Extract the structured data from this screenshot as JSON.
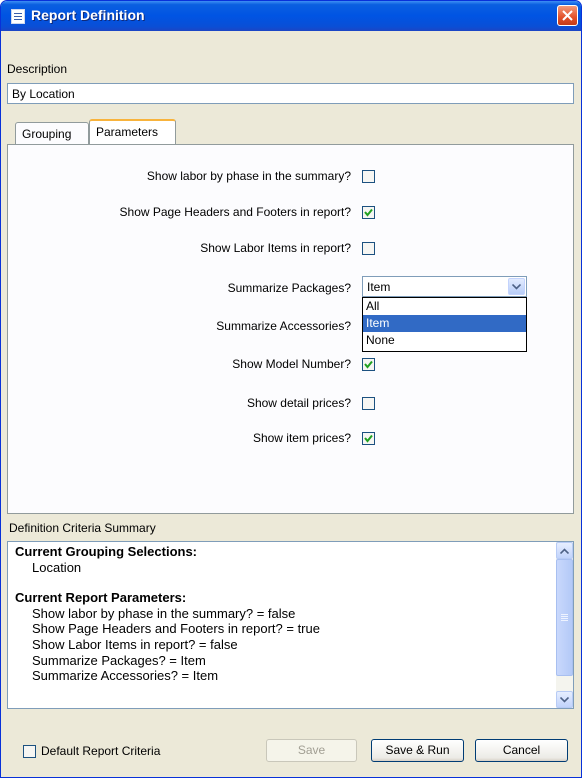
{
  "window": {
    "title": "Report Definition"
  },
  "description": {
    "label": "Description",
    "value": "By Location"
  },
  "tabs": [
    {
      "label": "Grouping"
    },
    {
      "label": "Parameters"
    }
  ],
  "parameters": {
    "labor_by_phase": {
      "label": "Show labor by phase in the summary?",
      "checked": false
    },
    "page_headers": {
      "label": "Show Page Headers and Footers in report?",
      "checked": true
    },
    "labor_items": {
      "label": "Show Labor Items in report?",
      "checked": false
    },
    "summarize_packages": {
      "label": "Summarize Packages?",
      "value": "Item",
      "options": [
        "All",
        "Item",
        "None"
      ]
    },
    "summarize_accessories": {
      "label": "Summarize Accessories?"
    },
    "model_number": {
      "label": "Show Model Number?",
      "checked": true
    },
    "detail_prices": {
      "label": "Show detail prices?",
      "checked": false
    },
    "item_prices": {
      "label": "Show item prices?",
      "checked": true
    }
  },
  "summary": {
    "label": "Definition Criteria Summary",
    "grouping_heading": "Current Grouping Selections:",
    "grouping_items": [
      "Location"
    ],
    "params_heading": "Current Report Parameters:",
    "param_items": [
      "Show labor by phase in the summary? = false",
      "Show Page Headers and Footers in report? = true",
      "Show Labor Items in report? = false",
      "Summarize Packages? = Item",
      "Summarize Accessories? = Item"
    ]
  },
  "footer": {
    "default_criteria": {
      "label": "Default Report Criteria",
      "checked": false
    },
    "save": "Save",
    "save_run": "Save & Run",
    "cancel": "Cancel"
  },
  "colors": {
    "titlebar": "#0054e3",
    "selection": "#316ac5",
    "active_tab": "#f8b33c",
    "check": "#21a121"
  }
}
